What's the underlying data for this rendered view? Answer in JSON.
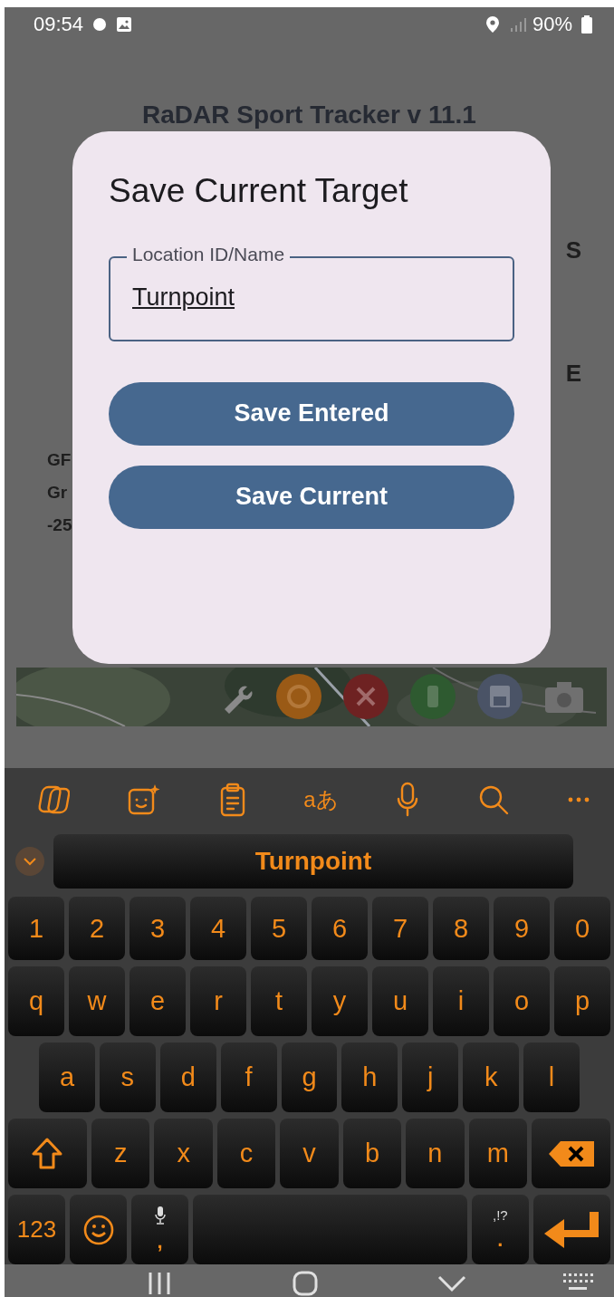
{
  "status_bar": {
    "time": "09:54",
    "battery": "90%"
  },
  "app": {
    "title": "RaDAR Sport Tracker v 11.1",
    "side_labels": [
      "S",
      "E"
    ],
    "info_lines": [
      "GF",
      "Gr",
      "-25"
    ],
    "map_tools": [
      {
        "kind": "wrench"
      },
      {
        "kind": "target"
      },
      {
        "kind": "cancel"
      },
      {
        "kind": "green"
      },
      {
        "kind": "save"
      },
      {
        "kind": "camera"
      }
    ]
  },
  "dialog": {
    "title": "Save Current Target",
    "field": {
      "label": "Location ID/Name",
      "value": "Turnpoint"
    },
    "buttons": [
      "Save Entered",
      "Save Current"
    ]
  },
  "keyboard": {
    "toolbar": [
      {
        "kind": "copilot"
      },
      {
        "kind": "sticker"
      },
      {
        "kind": "clipboard"
      },
      {
        "kind": "translate",
        "label": "aあ"
      },
      {
        "kind": "mic"
      },
      {
        "kind": "search"
      },
      {
        "kind": "more"
      }
    ],
    "suggestion": "Turnpoint",
    "rows": [
      [
        {
          "kind": "char",
          "label": "1"
        },
        {
          "kind": "char",
          "label": "2"
        },
        {
          "kind": "char",
          "label": "3"
        },
        {
          "kind": "char",
          "label": "4"
        },
        {
          "kind": "char",
          "label": "5"
        },
        {
          "kind": "char",
          "label": "6"
        },
        {
          "kind": "char",
          "label": "7"
        },
        {
          "kind": "char",
          "label": "8"
        },
        {
          "kind": "char",
          "label": "9"
        },
        {
          "kind": "char",
          "label": "0"
        }
      ],
      [
        {
          "kind": "char",
          "label": "q"
        },
        {
          "kind": "char",
          "label": "w"
        },
        {
          "kind": "char",
          "label": "e"
        },
        {
          "kind": "char",
          "label": "r"
        },
        {
          "kind": "char",
          "label": "t"
        },
        {
          "kind": "char",
          "label": "y"
        },
        {
          "kind": "char",
          "label": "u"
        },
        {
          "kind": "char",
          "label": "i"
        },
        {
          "kind": "char",
          "label": "o"
        },
        {
          "kind": "char",
          "label": "p"
        }
      ],
      [
        {
          "kind": "char",
          "label": "a"
        },
        {
          "kind": "char",
          "label": "s"
        },
        {
          "kind": "char",
          "label": "d"
        },
        {
          "kind": "char",
          "label": "f"
        },
        {
          "kind": "char",
          "label": "g"
        },
        {
          "kind": "char",
          "label": "h"
        },
        {
          "kind": "char",
          "label": "j"
        },
        {
          "kind": "char",
          "label": "k"
        },
        {
          "kind": "char",
          "label": "l"
        }
      ],
      [
        {
          "kind": "shift"
        },
        {
          "kind": "char",
          "label": "z"
        },
        {
          "kind": "char",
          "label": "x"
        },
        {
          "kind": "char",
          "label": "c"
        },
        {
          "kind": "char",
          "label": "v"
        },
        {
          "kind": "char",
          "label": "b"
        },
        {
          "kind": "char",
          "label": "n"
        },
        {
          "kind": "char",
          "label": "m"
        },
        {
          "kind": "backspace"
        }
      ],
      [
        {
          "kind": "symbols",
          "label": "123"
        },
        {
          "kind": "emoji"
        },
        {
          "kind": "comma",
          "label": ","
        },
        {
          "kind": "space"
        },
        {
          "kind": "period",
          "label": ".",
          "hint": ",!?"
        },
        {
          "kind": "enter"
        }
      ]
    ]
  },
  "nav_bar": [
    {
      "kind": "recents"
    },
    {
      "kind": "home"
    },
    {
      "kind": "back"
    },
    {
      "kind": "keyboard"
    }
  ]
}
